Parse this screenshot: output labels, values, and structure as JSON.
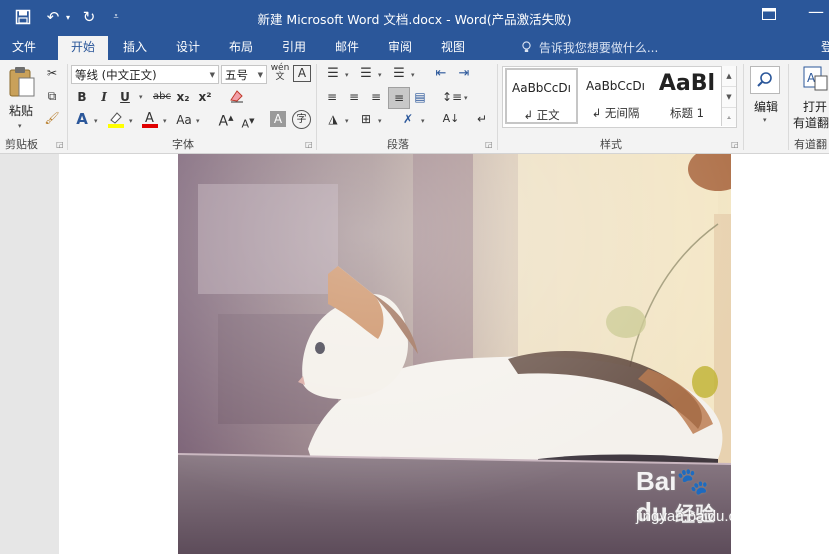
{
  "window": {
    "title": "新建 Microsoft Word 文档.docx - Word(产品激活失败)",
    "quick_access": {
      "save_icon": "save-icon",
      "undo_icon": "undo-icon",
      "redo_icon": "redo-icon",
      "customize_icon": "customize-qat-icon"
    }
  },
  "tabs": [
    {
      "label": "文件"
    },
    {
      "label": "开始"
    },
    {
      "label": "插入"
    },
    {
      "label": "设计"
    },
    {
      "label": "布局"
    },
    {
      "label": "引用"
    },
    {
      "label": "邮件"
    },
    {
      "label": "审阅"
    },
    {
      "label": "视图"
    }
  ],
  "active_tab": "开始",
  "tell_me": "告诉我您想要做什么...",
  "ribbon": {
    "clipboard": {
      "label": "剪贴板",
      "paste": "粘贴"
    },
    "font": {
      "label": "字体",
      "font_name": "等线 (中文正文)",
      "font_size": "五号",
      "bold": "B",
      "italic": "I",
      "underline": "U",
      "strike": "abc",
      "subscript": "x₂",
      "superscript": "x²",
      "change_case": "Aa",
      "grow": "A",
      "shrink": "A",
      "phonetic": "wén",
      "enclose": "字"
    },
    "paragraph": {
      "label": "段落"
    },
    "styles": {
      "label": "样式",
      "items": [
        {
          "sample": "AaBbCcDı",
          "name": "↲ 正文"
        },
        {
          "sample": "AaBbCcDı",
          "name": "↲ 无间隔"
        },
        {
          "sample": "AaBl",
          "name": "标题 1"
        }
      ]
    },
    "editing": {
      "label": "编辑"
    },
    "youdao": {
      "label": "有道翻",
      "open": "打开",
      "name": "有道翻"
    }
  },
  "colors": {
    "brand": "#2b579a",
    "ribbon_bg": "#f3f3f3",
    "highlight": "#ffff00",
    "font_color": "#e00000"
  },
  "watermark": {
    "brand": "Bai du 经验",
    "url": "jingyan.baidu.com"
  }
}
